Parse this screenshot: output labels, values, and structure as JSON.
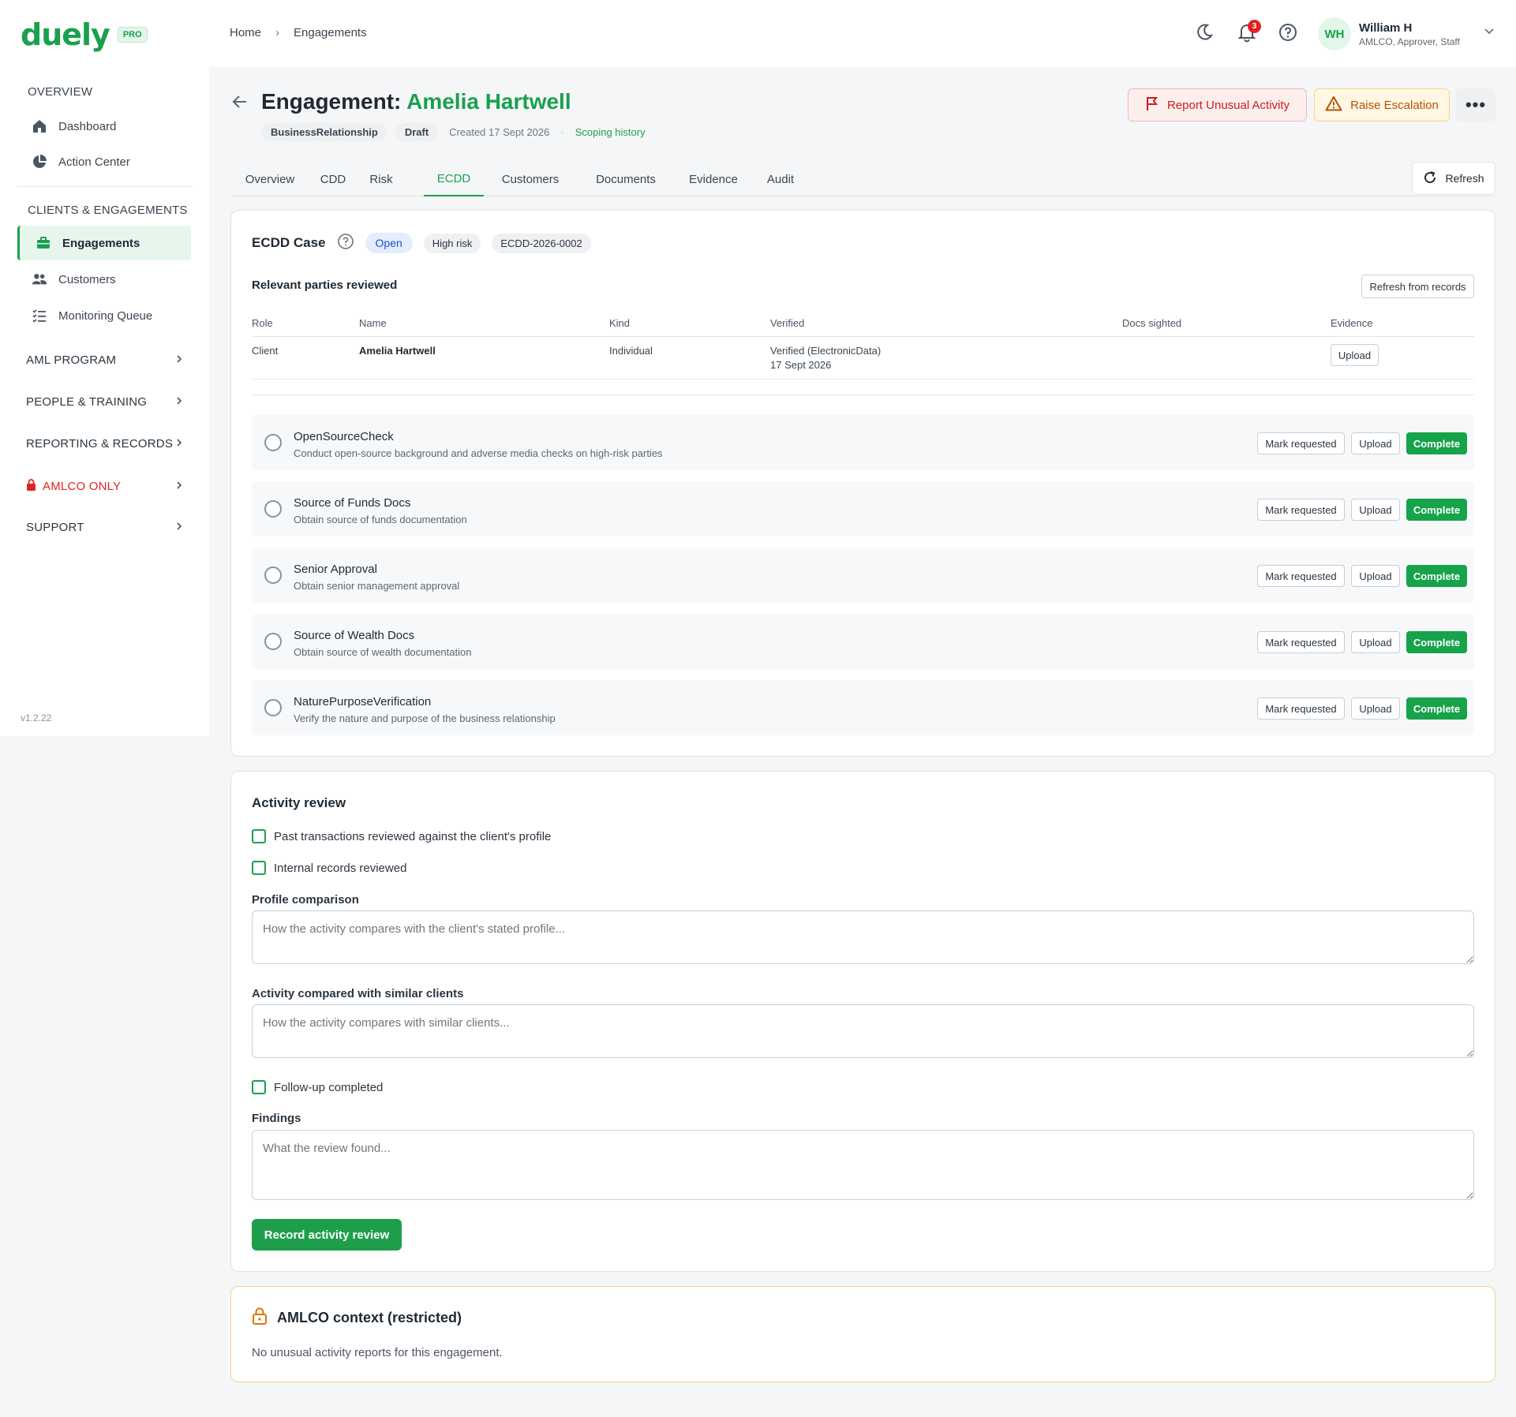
{
  "brand": {
    "name": "duely",
    "tier": "PRO"
  },
  "sidebar": {
    "sections": [
      {
        "title": "OVERVIEW",
        "items": [
          {
            "label": "Dashboard",
            "icon": "home-icon"
          },
          {
            "label": "Action Center",
            "icon": "pie-chart-icon"
          }
        ]
      },
      {
        "title": "CLIENTS & ENGAGEMENTS",
        "items": [
          {
            "label": "Engagements",
            "icon": "briefcase-icon",
            "active": true
          },
          {
            "label": "Customers",
            "icon": "users-icon"
          },
          {
            "label": "Monitoring Queue",
            "icon": "list-check-icon"
          }
        ]
      }
    ],
    "groups": [
      "AML PROGRAM",
      "PEOPLE & TRAINING",
      "REPORTING & RECORDS",
      "AMLCO ONLY",
      "SUPPORT"
    ],
    "version": "v1.2.22"
  },
  "topbar": {
    "breadcrumb": [
      "Home",
      "Engagements"
    ],
    "notifications_count": "3",
    "user": {
      "initials": "WH",
      "name": "William H",
      "role": "AMLCO, Approver, Staff"
    }
  },
  "header": {
    "title_prefix": "Engagement: ",
    "title_name": "Amelia Hartwell",
    "chips": [
      "BusinessRelationship",
      "Draft"
    ],
    "created": "Created 17 Sept 2026",
    "scoping_link": "Scoping history",
    "report_label": "Report Unusual Activity",
    "escalate_label": "Raise Escalation",
    "more_label": "•••"
  },
  "tabs": {
    "items": [
      "Overview",
      "CDD",
      "Risk",
      "ECDD",
      "Customers",
      "Documents",
      "Evidence",
      "Audit"
    ],
    "active": "ECDD",
    "refresh_label": "Refresh"
  },
  "ecdd": {
    "title": "ECDD Case",
    "status": "Open",
    "risk": "High risk",
    "case_id": "ECDD-2026-0002",
    "parties_title": "Relevant parties reviewed",
    "refresh_records_label": "Refresh from records",
    "columns": [
      "Role",
      "Name",
      "Kind",
      "Verified",
      "Docs sighted",
      "Evidence"
    ],
    "parties": [
      {
        "role": "Client",
        "name": "Amelia Hartwell",
        "kind": "Individual",
        "verified": "Verified (ElectronicData)",
        "verified_date": "17 Sept 2026",
        "docs_sighted": "",
        "evidence_btn": "Upload"
      }
    ],
    "task_buttons": {
      "request": "Mark requested",
      "upload": "Upload",
      "complete": "Complete"
    },
    "tasks": [
      {
        "name": "OpenSourceCheck",
        "desc": "Conduct open-source background and adverse media checks on high-risk parties"
      },
      {
        "name": "Source of Funds Docs",
        "desc": "Obtain source of funds documentation"
      },
      {
        "name": "Senior Approval",
        "desc": "Obtain senior management approval"
      },
      {
        "name": "Source of Wealth Docs",
        "desc": "Obtain source of wealth documentation"
      },
      {
        "name": "NaturePurposeVerification",
        "desc": "Verify the nature and purpose of the business relationship"
      }
    ]
  },
  "activity": {
    "title": "Activity review",
    "check_transactions": "Past transactions reviewed against the client's profile",
    "check_internal": "Internal records reviewed",
    "profile_label": "Profile comparison",
    "profile_placeholder": "How the activity compares with the client's stated profile...",
    "similar_label": "Activity compared with similar clients",
    "similar_placeholder": "How the activity compares with similar clients...",
    "check_followup": "Follow-up completed",
    "findings_label": "Findings",
    "findings_placeholder": "What the review found...",
    "submit_label": "Record activity review"
  },
  "amlco": {
    "title": "AMLCO context (restricted)",
    "text": "No unusual activity reports for this engagement."
  },
  "colors": {
    "brand_green": "#1aa04e",
    "danger": "#e02424",
    "warning": "#b45309"
  }
}
